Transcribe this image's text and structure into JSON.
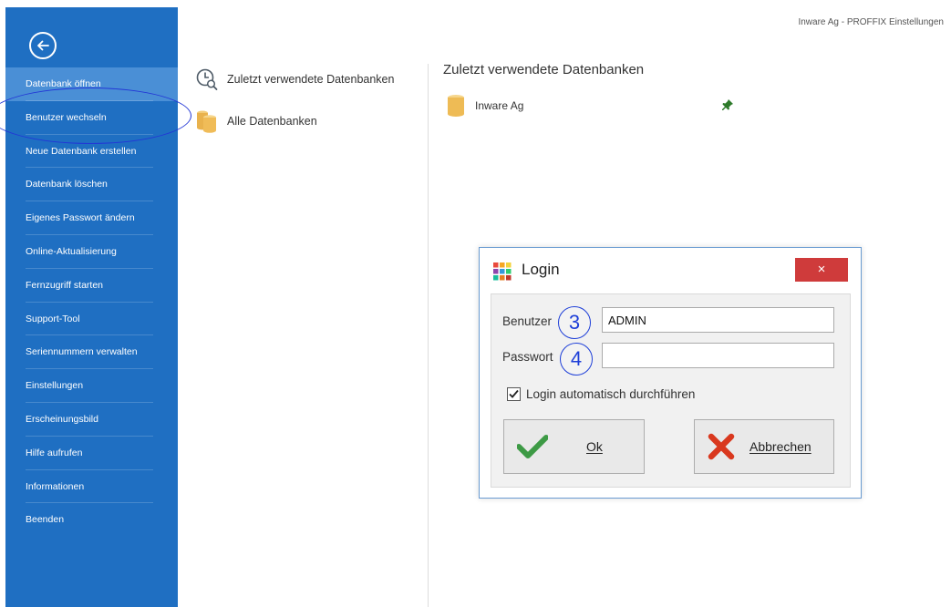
{
  "window": {
    "title": "Inware Ag - PROFFIX Einstellungen"
  },
  "sidebar": {
    "back_icon": "back-arrow-circle-icon",
    "items": [
      {
        "label": "Datenbank öffnen",
        "active": true
      },
      {
        "label": "Benutzer wechseln",
        "active": false
      },
      {
        "label": "Neue Datenbank erstellen",
        "active": false
      },
      {
        "label": "Datenbank löschen",
        "active": false
      },
      {
        "label": "Eigenes Passwort ändern",
        "active": false
      },
      {
        "label": "Online-Aktualisierung",
        "active": false
      },
      {
        "label": "Fernzugriff starten",
        "active": false
      },
      {
        "label": "Support-Tool",
        "active": false
      },
      {
        "label": "Seriennummern verwalten",
        "active": false
      },
      {
        "label": "Einstellungen",
        "active": false
      },
      {
        "label": "Erscheinungsbild",
        "active": false
      },
      {
        "label": "Hilfe aufrufen",
        "active": false
      },
      {
        "label": "Informationen",
        "active": false
      },
      {
        "label": "Beenden",
        "active": false
      }
    ]
  },
  "middle": {
    "recent": {
      "label": "Zuletzt verwendete Datenbanken",
      "icon": "clock-search-icon"
    },
    "all": {
      "label": "Alle Datenbanken",
      "icon": "database-stack-icon"
    }
  },
  "right": {
    "title": "Zuletzt verwendete Datenbanken",
    "databases": [
      {
        "name": "Inware Ag",
        "icon": "database-icon",
        "pin_icon": "pin-icon"
      }
    ]
  },
  "login": {
    "title": "Login",
    "close_label": "×",
    "user": {
      "label": "Benutzer",
      "value": "ADMIN",
      "step": "3"
    },
    "password": {
      "label": "Passwort",
      "value": "",
      "step": "4"
    },
    "auto_login": {
      "label": "Login automatisch durchführen",
      "checked": true
    },
    "ok_button": {
      "label": "Ok",
      "icon": "checkmark-icon"
    },
    "cancel_button": {
      "label": "Abbrechen",
      "icon": "red-x-icon"
    }
  },
  "colors": {
    "sidebar": "#1f6fc2",
    "sidebar_active": "#4a8fd6",
    "annotation": "#1e3fd8",
    "close_button": "#cf3b3b",
    "check_green": "#3d9a45",
    "cancel_red": "#d9381e"
  }
}
